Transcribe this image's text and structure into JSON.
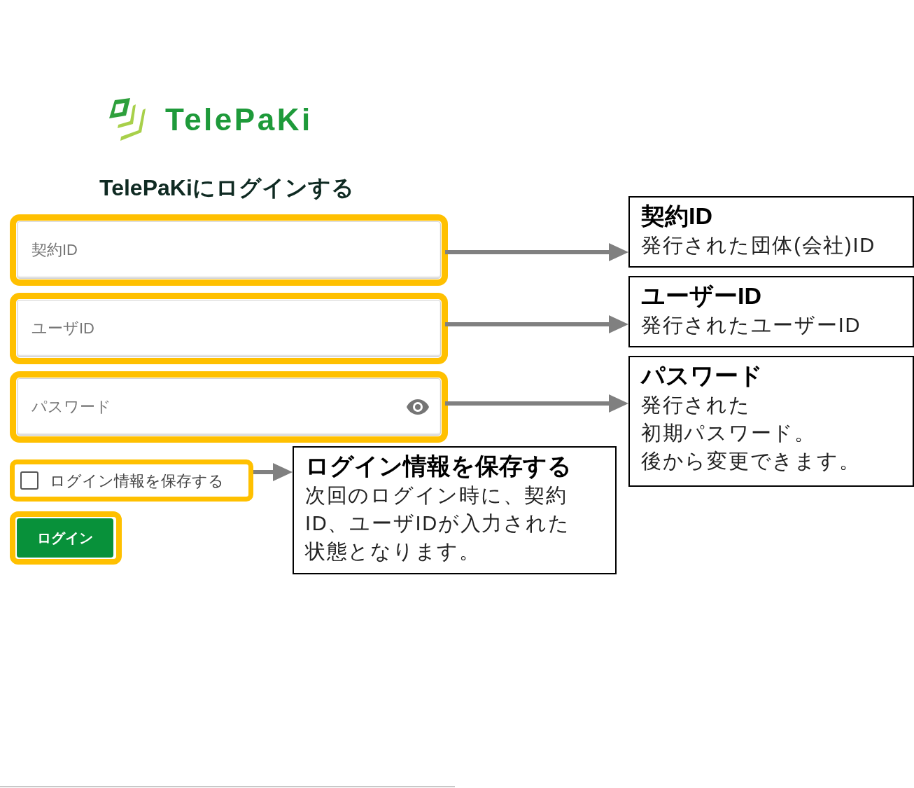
{
  "logo": {
    "name": "TelePaKi"
  },
  "heading": "TelePaKiにログインする",
  "fields": [
    {
      "placeholder": "契約ID",
      "kind": "text"
    },
    {
      "placeholder": "ユーザID",
      "kind": "text"
    },
    {
      "placeholder": "パスワード",
      "kind": "password"
    }
  ],
  "remember": {
    "label": "ログイン情報を保存する",
    "checked": false
  },
  "login_button": "ログイン",
  "callouts": [
    {
      "title": "契約ID",
      "text": "発行された団体(会社)ID"
    },
    {
      "title": "ユーザーID",
      "text": "発行されたユーザーID"
    },
    {
      "title": "パスワード",
      "lines": [
        "発行された",
        "初期パスワード。",
        "後から変更できます。"
      ]
    },
    {
      "title": "ログイン情報を保存する",
      "lines": [
        "次回のログイン時に、契約",
        "ID、ユーザIDが入力された",
        "状態となります。"
      ]
    }
  ]
}
